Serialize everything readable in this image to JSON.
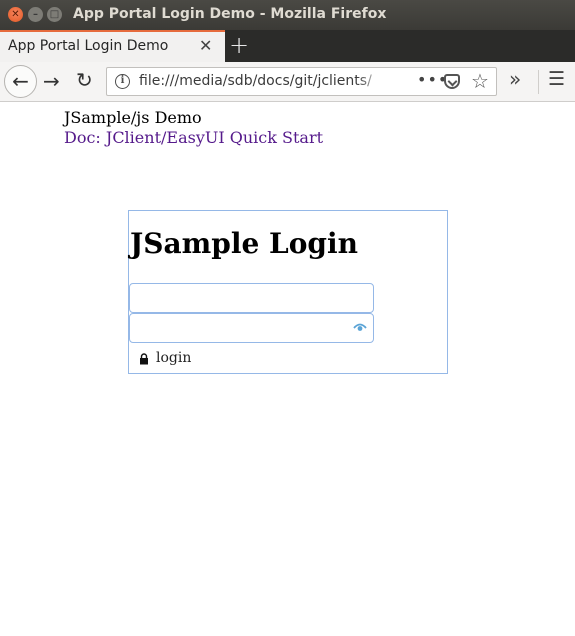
{
  "window": {
    "title": "App Portal Login Demo - Mozilla Firefox",
    "close_glyph": "✕",
    "minimize_glyph": "–",
    "maximize_glyph": "□"
  },
  "tabs": [
    {
      "title": "App Portal Login Demo",
      "close_glyph": "✕"
    }
  ],
  "new_tab_glyph": "+",
  "toolbar": {
    "back_glyph": "←",
    "forward_glyph": "→",
    "reload_glyph": "↻",
    "info_glyph": "i",
    "url": "file:///media/sdb/docs/git/jclients/",
    "more_glyph": "•••",
    "star_glyph": "☆",
    "overflow_glyph": "»",
    "menu_glyph": "☰"
  },
  "page": {
    "heading": "JSample/js Demo",
    "doc_link": "Doc: JClient/EasyUI Quick Start",
    "link_color": "#551a8b"
  },
  "login": {
    "title": "JSample Login",
    "username_value": "",
    "password_value": "",
    "button_label": "login",
    "border_color": "#95b8e7",
    "eye_color": "#5ba4d6"
  }
}
